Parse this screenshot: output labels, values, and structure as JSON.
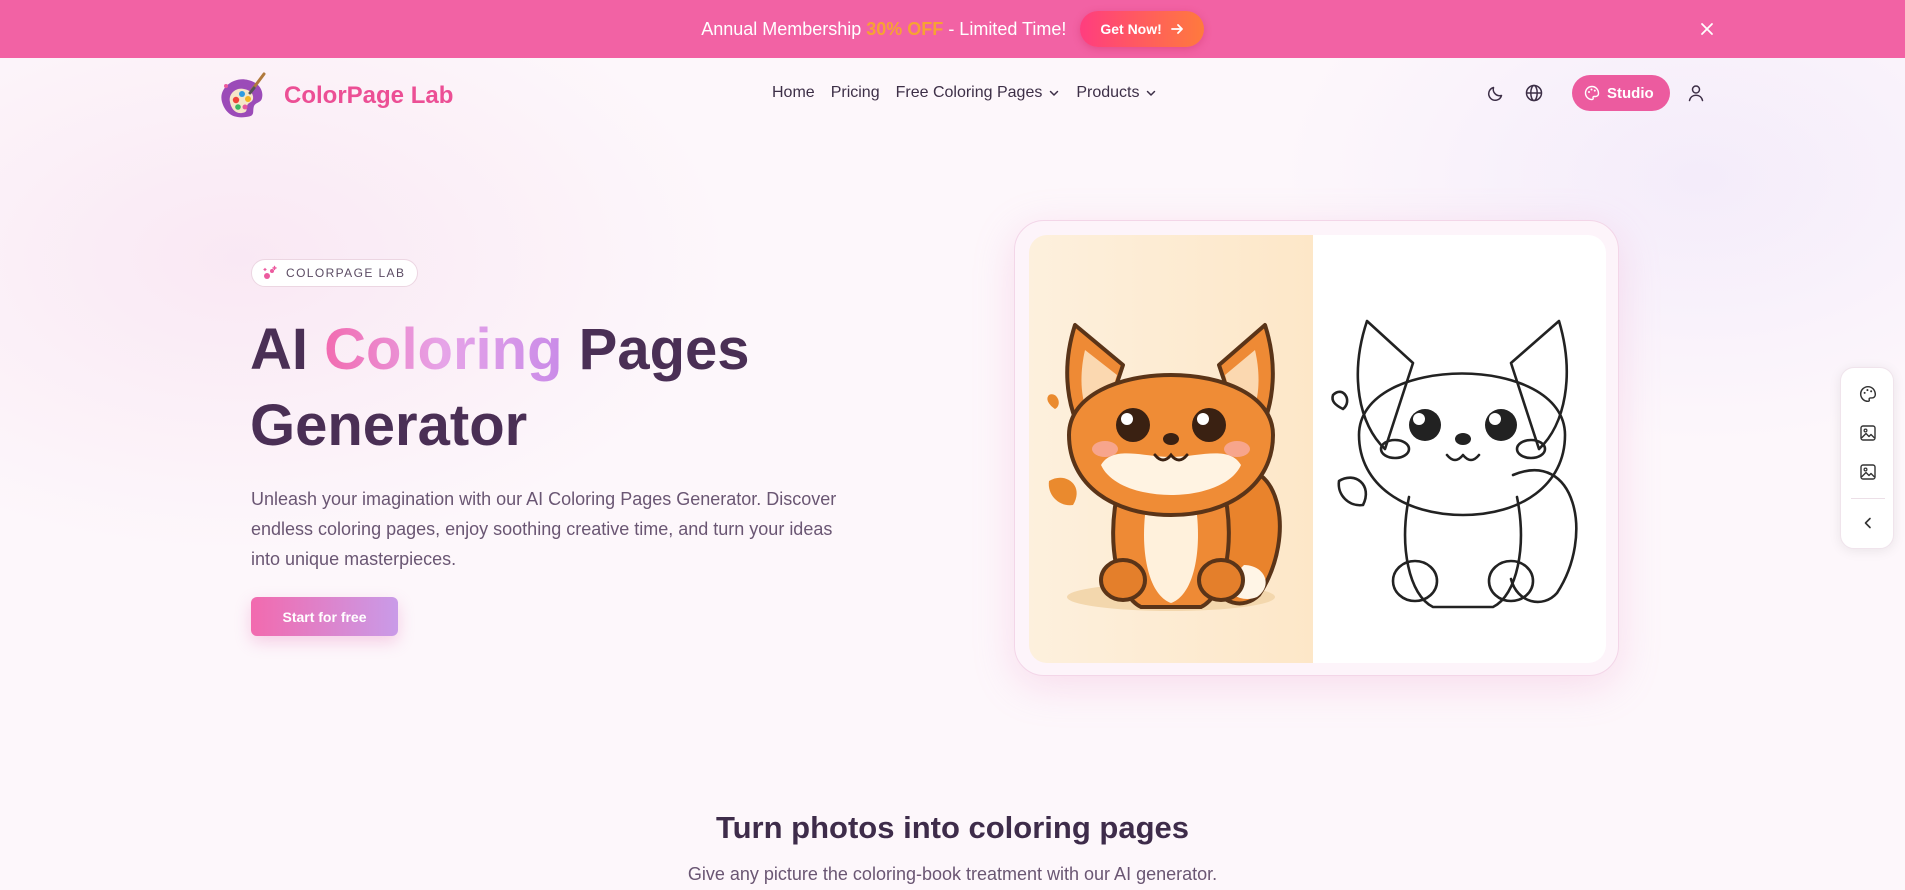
{
  "promo": {
    "text_before": "Annual Membership ",
    "highlight": "30% OFF",
    "text_after": " - Limited Time!",
    "cta_label": "Get Now!",
    "colors": {
      "banner": "#f262a4",
      "highlight": "#f7a233"
    }
  },
  "brand": {
    "name": "ColorPage Lab",
    "color": "#ec4f95"
  },
  "nav": {
    "links": [
      {
        "label": "Home"
      },
      {
        "label": "Pricing"
      },
      {
        "label": "Free Coloring Pages"
      },
      {
        "label": "Products"
      }
    ],
    "studio_label": "Studio"
  },
  "hero": {
    "badge": "COLORPAGE LAB",
    "title_part1": "AI ",
    "title_highlight": "Coloring",
    "title_part2": " Pages",
    "title_line2": "Generator",
    "description": "Unleash your imagination with our AI Coloring Pages Generator. Discover endless coloring pages, enjoy soothing creative time, and turn your ideas into unique masterpieces.",
    "cta_label": "Start for free"
  },
  "section": {
    "title": "Turn photos into coloring pages",
    "subtitle": "Give any picture the coloring-book treatment with our AI generator."
  },
  "icons": {
    "promo_arrow": "arrow-right-icon",
    "promo_close": "close-icon",
    "theme": "moon-icon",
    "language": "globe-icon",
    "studio": "palette-icon",
    "account": "user-icon",
    "side_tools": [
      "palette-icon",
      "image-icon",
      "image-icon",
      "chevron-left-icon"
    ]
  }
}
